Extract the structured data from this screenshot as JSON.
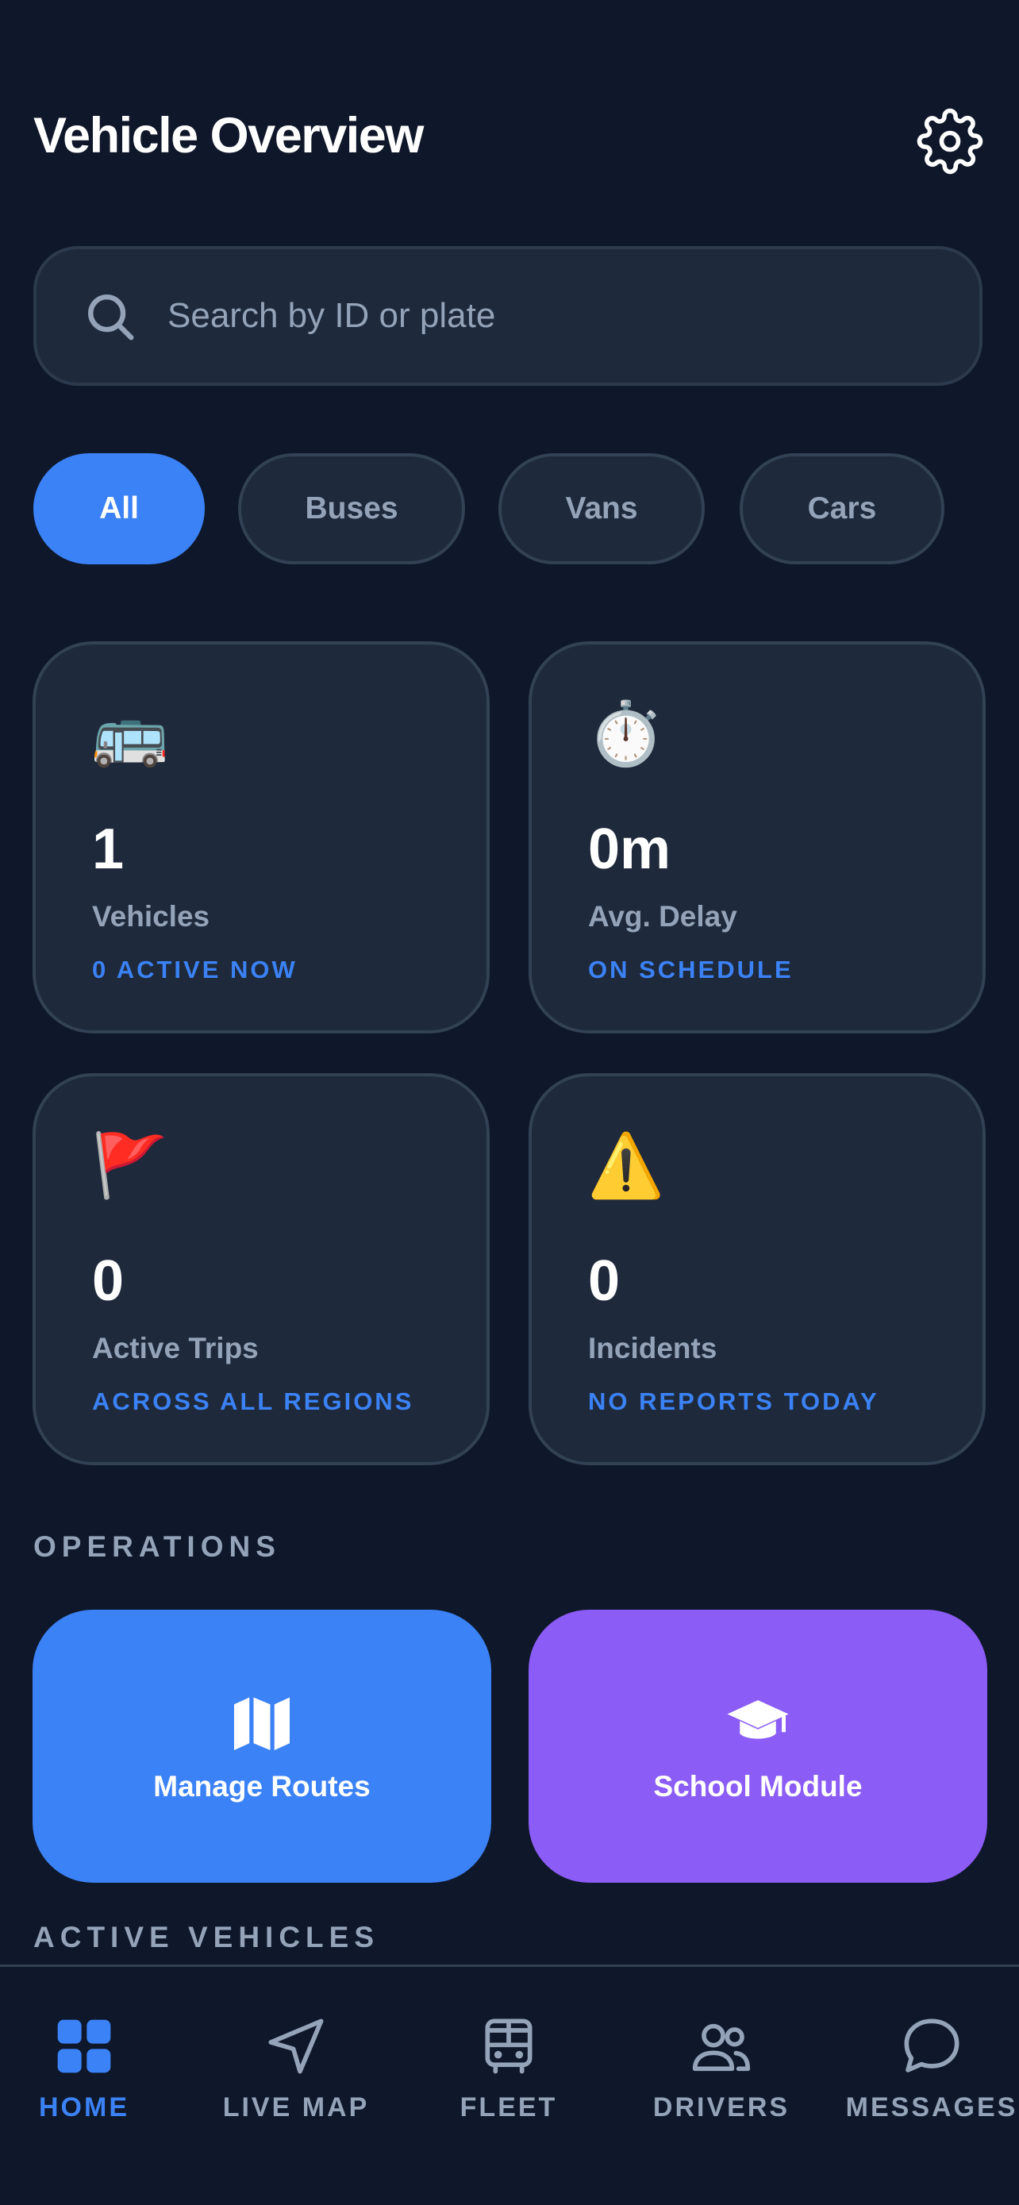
{
  "header": {
    "title": "Vehicle Overview",
    "settings_icon": "gear-icon"
  },
  "search": {
    "placeholder": "Search by ID or plate",
    "value": "",
    "icon": "search-icon"
  },
  "filters": {
    "selected": "All",
    "chips": [
      {
        "label": "All",
        "active": true
      },
      {
        "label": "Buses",
        "active": false
      },
      {
        "label": "Vans",
        "active": false
      },
      {
        "label": "Cars",
        "active": false
      }
    ]
  },
  "stats": [
    {
      "icon": "🚌",
      "icon_name": "bus-icon",
      "value": "1",
      "label": "Vehicles",
      "sub": "0 ACTIVE NOW"
    },
    {
      "icon": "⏱️",
      "icon_name": "stopwatch-icon",
      "value": "0m",
      "label": "Avg. Delay",
      "sub": "ON SCHEDULE"
    },
    {
      "icon": "🚩",
      "icon_name": "flag-icon",
      "value": "0",
      "label": "Active Trips",
      "sub": "ACROSS ALL REGIONS"
    },
    {
      "icon": "⚠️",
      "icon_name": "warning-icon",
      "value": "0",
      "label": "Incidents",
      "sub": "NO REPORTS TODAY"
    }
  ],
  "operations": {
    "heading": "OPERATIONS",
    "items": [
      {
        "label": "Manage Routes",
        "icon": "map-icon",
        "color": "#3b82f6"
      },
      {
        "label": "School Module",
        "icon": "graduation-cap-icon",
        "color": "#8b5cf6"
      }
    ]
  },
  "active_vehicles": {
    "heading": "ACTIVE VEHICLES"
  },
  "nav": {
    "items": [
      {
        "label": "HOME",
        "icon": "grid-icon",
        "active": true
      },
      {
        "label": "LIVE MAP",
        "icon": "navigation-arrow-icon",
        "active": false
      },
      {
        "label": "FLEET",
        "icon": "bus-front-icon",
        "active": false
      },
      {
        "label": "DRIVERS",
        "icon": "users-icon",
        "active": false
      },
      {
        "label": "MESSAGES",
        "icon": "chat-bubble-icon",
        "active": false
      }
    ]
  },
  "colors": {
    "background": "#0f172a",
    "card": "#1e293b",
    "accent": "#3b82f6",
    "purple": "#8b5cf6",
    "muted": "#94a3b8"
  }
}
